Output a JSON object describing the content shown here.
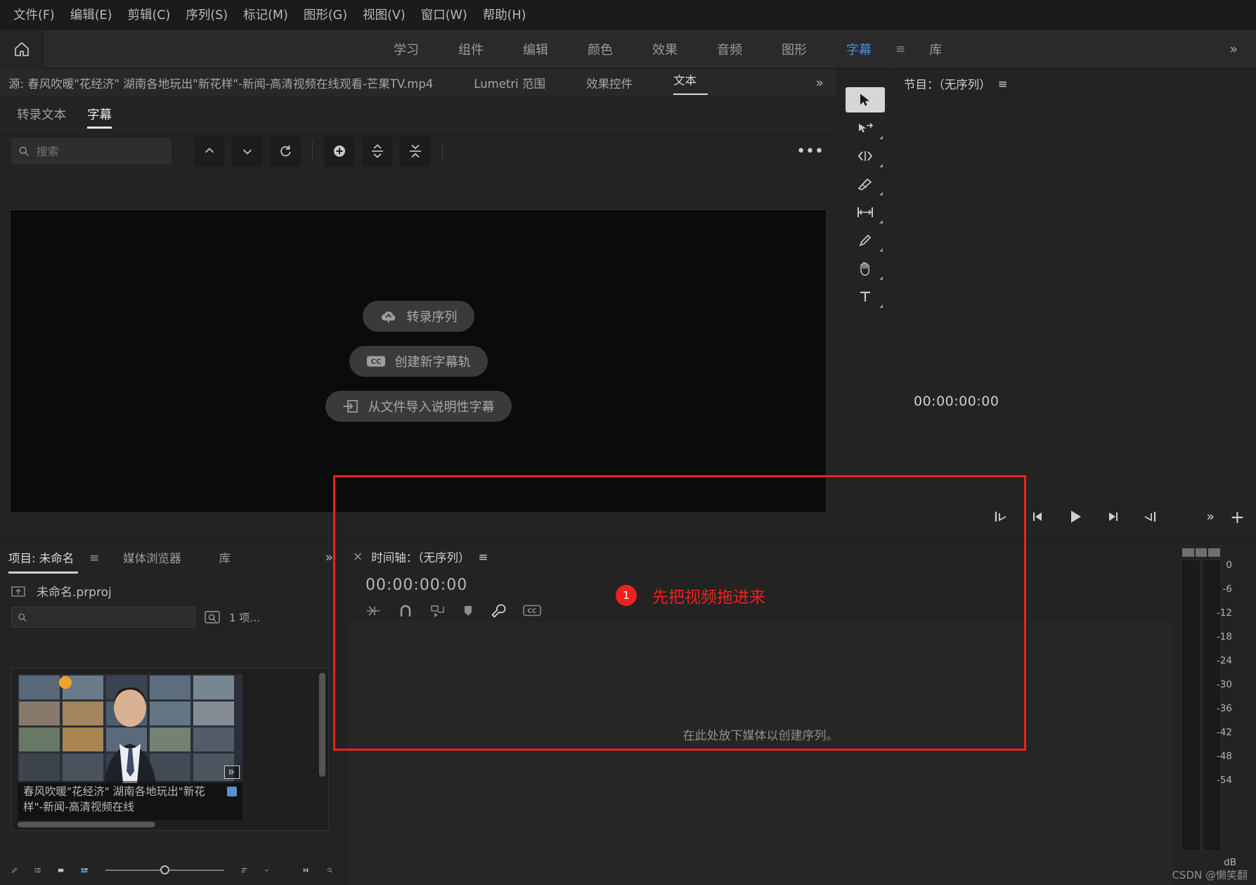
{
  "menubar": {
    "items": [
      {
        "label": "文件(F)"
      },
      {
        "label": "编辑(E)"
      },
      {
        "label": "剪辑(C)"
      },
      {
        "label": "序列(S)"
      },
      {
        "label": "标记(M)"
      },
      {
        "label": "图形(G)"
      },
      {
        "label": "视图(V)"
      },
      {
        "label": "窗口(W)"
      },
      {
        "label": "帮助(H)"
      }
    ]
  },
  "workspace": {
    "home_icon": "home-icon",
    "tabs": [
      {
        "label": "学习",
        "active": false
      },
      {
        "label": "组件",
        "active": false
      },
      {
        "label": "编辑",
        "active": false
      },
      {
        "label": "颜色",
        "active": false
      },
      {
        "label": "效果",
        "active": false
      },
      {
        "label": "音频",
        "active": false
      },
      {
        "label": "图形",
        "active": false
      },
      {
        "label": "字幕",
        "active": true
      },
      {
        "label": "库",
        "active": false
      }
    ],
    "burger": "≡",
    "overflow": "»",
    "active_color": "#4d90d8"
  },
  "source_panel": {
    "tabs": [
      {
        "label": "源: 春风吹暖\"花经济\" 湖南各地玩出\"新花样\"-新闻-高清视频在线观看-芒果TV.mp4",
        "active": false
      },
      {
        "label": "Lumetri 范围",
        "active": false
      },
      {
        "label": "效果控件",
        "active": false
      },
      {
        "label": "文本",
        "active": true
      }
    ],
    "overflow": "»",
    "subtabs": [
      {
        "label": "转录文本",
        "active": false
      },
      {
        "label": "字幕",
        "active": true
      }
    ],
    "toolbar": {
      "search_placeholder": "搜索",
      "search_value": "",
      "buttons": [
        {
          "name": "caption-prev-button",
          "glyph": "chevron-up-icon"
        },
        {
          "name": "caption-next-button",
          "glyph": "chevron-down-icon"
        },
        {
          "name": "caption-refresh-button",
          "glyph": "refresh-icon"
        },
        {
          "name": "caption-add-button",
          "glyph": "plus-circle-icon"
        },
        {
          "name": "caption-split-button",
          "glyph": "split-icon"
        },
        {
          "name": "caption-merge-button",
          "glyph": "merge-icon"
        }
      ],
      "more": "…"
    },
    "empty_actions": [
      {
        "label": "转录序列",
        "icon": "cloud-upload-icon"
      },
      {
        "label": "创建新字幕轨",
        "icon": "cc-icon"
      },
      {
        "label": "从文件导入说明性字幕",
        "icon": "import-arrow-icon"
      }
    ]
  },
  "tools": [
    {
      "name": "selection-tool",
      "icon": "cursor-arrow-icon",
      "selected": true
    },
    {
      "name": "track-select-tool",
      "icon": "track-select-icon",
      "selected": false
    },
    {
      "name": "ripple-edit-tool",
      "icon": "ripple-edit-icon",
      "selected": false
    },
    {
      "name": "razor-tool",
      "icon": "razor-icon",
      "selected": false
    },
    {
      "name": "slip-tool",
      "icon": "slip-icon",
      "selected": false
    },
    {
      "name": "pen-tool",
      "icon": "pen-icon",
      "selected": false
    },
    {
      "name": "hand-tool",
      "icon": "hand-icon",
      "selected": false
    },
    {
      "name": "type-tool",
      "icon": "type-icon",
      "selected": false
    }
  ],
  "program_monitor": {
    "title": "节目：（无序列）",
    "burger": "≡",
    "timecode": "00:00:00:00",
    "transport": [
      {
        "name": "go-to-in-button",
        "icon": "go-to-in-icon"
      },
      {
        "name": "step-back-button",
        "icon": "step-back-icon"
      },
      {
        "name": "play-button",
        "icon": "play-icon"
      },
      {
        "name": "step-forward-button",
        "icon": "step-forward-icon"
      },
      {
        "name": "go-to-out-button",
        "icon": "go-to-out-icon"
      }
    ],
    "overflow": "»",
    "add_button": "+"
  },
  "project_panel": {
    "tabs": [
      {
        "label": "项目: 未命名",
        "active": true
      },
      {
        "label": "媒体浏览器",
        "active": false
      },
      {
        "label": "库",
        "active": false
      }
    ],
    "overflow": "»",
    "file_name": "未命名.prproj",
    "file_icon": "folder-up-icon",
    "search_placeholder": "",
    "search_value": "",
    "find_icon": "find-icon",
    "item_count": "1 项…",
    "clip": {
      "title": "春风吹暖\"花经济\" 湖南各地玩出\"新花样\"-新闻-高清视频在线",
      "badge": "insert-icon",
      "color_dot": "#5a8fd0"
    },
    "footer_buttons": [
      {
        "name": "new-item-pen-icon",
        "icon": "pen-icon"
      },
      {
        "name": "list-view-icon",
        "icon": "list-view-icon"
      },
      {
        "name": "icon-view-icon",
        "icon": "icon-view-icon"
      },
      {
        "name": "freeform-view-icon",
        "icon": "freeform-view-icon"
      },
      {
        "name": "zoom-slider",
        "icon": "slider-icon"
      },
      {
        "name": "sort-icon",
        "icon": "sort-icon"
      },
      {
        "name": "sort-chevron-icon",
        "icon": "chevron-down-icon"
      },
      {
        "name": "automate-to-sequence-icon",
        "icon": "automate-icon"
      },
      {
        "name": "find-icon",
        "icon": "magnifier-icon"
      }
    ]
  },
  "timeline": {
    "close": "×",
    "title": "时间轴：（无序列）",
    "burger": "≡",
    "timecode": "00:00:00:00",
    "tools": [
      {
        "name": "nest-icon",
        "icon": "nest-icon"
      },
      {
        "name": "snap-icon",
        "icon": "magnet-icon"
      },
      {
        "name": "linked-selection-icon",
        "icon": "link-icon"
      },
      {
        "name": "add-marker-icon",
        "icon": "marker-icon"
      },
      {
        "name": "timeline-settings-icon",
        "icon": "wrench-icon"
      },
      {
        "name": "captions-icon",
        "icon": "cc-icon"
      }
    ],
    "drop_hint": "在此处放下媒体以创建序列。",
    "annotation": {
      "number": "1",
      "text": "先把视频拖进来",
      "color": "#f02020"
    }
  },
  "audio_meters": {
    "scale": [
      "0",
      "-6",
      "-12",
      "-18",
      "-24",
      "-30",
      "-36",
      "-42",
      "-48",
      "-54"
    ],
    "unit": "dB"
  },
  "watermark": "CSDN @懒笑翻"
}
